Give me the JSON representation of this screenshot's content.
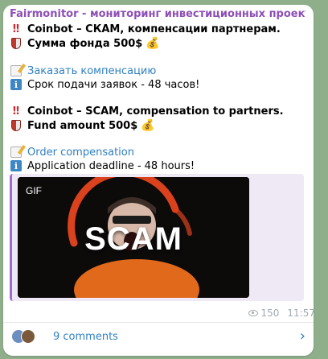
{
  "post": {
    "channel": "Fairmonitor - мониторинг инвестиционных проектов / 🇺🇸 ...",
    "ru_line1": "Coinbot – СКАМ, компенсации партнерам.",
    "ru_line2": "Сумма фонда 500$",
    "ru_link": "Заказать компенсацию",
    "ru_deadline": "Срок подачи заявок - 48 часов!",
    "en_line1": "Coinbot – SCAM, compensation to partners.",
    "en_line2": "Fund amount 500$",
    "en_link": "Order compensation",
    "en_deadline": "Application deadline - 48 hours!",
    "gif_badge": "GIF",
    "gif_text": "SCAM",
    "views": "150",
    "time": "11:57"
  },
  "comments": {
    "label": "9 comments"
  },
  "icons": {
    "exclamation": "double-exclamation-icon",
    "shield": "shield-icon",
    "money": "money-bag-icon",
    "memo": "memo-icon",
    "info": "info-icon",
    "views": "eye-icon",
    "chevron": "chevron-right-icon"
  }
}
